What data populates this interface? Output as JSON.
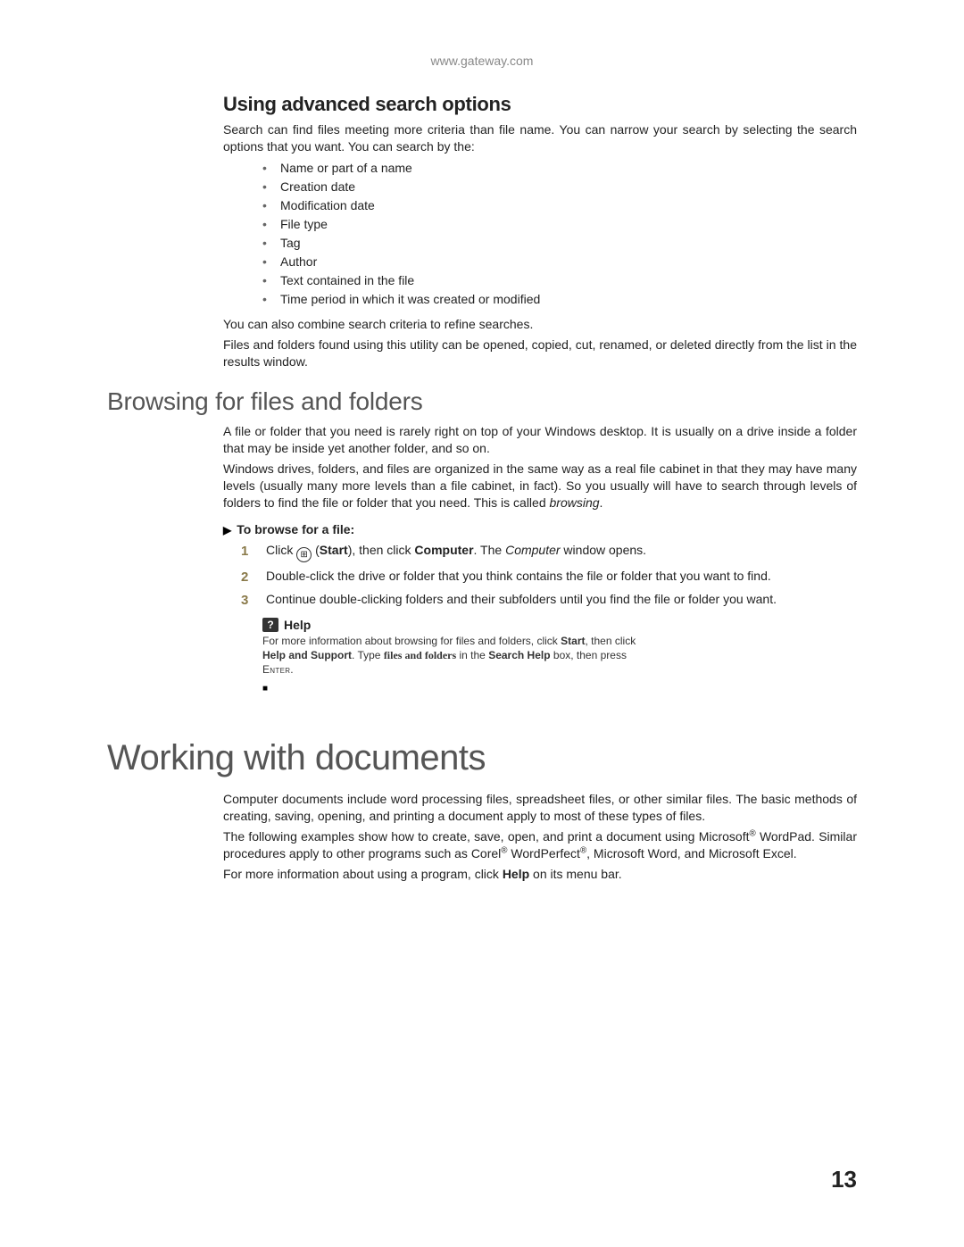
{
  "header": {
    "url": "www.gateway.com"
  },
  "sec1": {
    "heading": "Using advanced search options",
    "intro": "Search can find files meeting more criteria than file name. You can narrow your search by selecting the search options that you want. You can search by the:",
    "bullets": [
      "Name or part of a name",
      "Creation date",
      "Modification date",
      "File type",
      "Tag",
      "Author",
      "Text contained in the file",
      "Time period in which it was created or modified"
    ],
    "after1": "You can also combine search criteria to refine searches.",
    "after2": "Files and folders found using this utility can be opened, copied, cut, renamed, or deleted directly from the list in the results window."
  },
  "sec2": {
    "heading": "Browsing for files and folders",
    "p1": "A file or folder that you need is rarely right on top of your Windows desktop. It is usually on a drive inside a folder that may be inside yet another folder, and so on.",
    "p2a": "Windows drives, folders, and files are organized in the same way as a real file cabinet in that they may have many levels (usually many more levels than a file cabinet, in fact). So you usually will have to search through levels of folders to find the file or folder that you need. This is called ",
    "p2b": "browsing",
    "p2c": ".",
    "procHeading": "To browse for a file:",
    "step1": {
      "a": "Click ",
      "b": " (",
      "c": "Start",
      "d": "), then click ",
      "e": "Computer",
      "f": ". The ",
      "g": "Computer",
      "h": " window opens."
    },
    "step2": "Double-click the drive or folder that you think contains the file or folder that you want to find.",
    "step3": "Continue double-clicking folders and their subfolders until you find the file or folder you want.",
    "help": {
      "title": "Help",
      "a": "For more information about browsing for files and folders, click ",
      "b": "Start",
      "c": ", then click ",
      "d": "Help and Support",
      "e": ". Type ",
      "f": "files and folders",
      "g": " in the ",
      "h": "Search Help",
      "i": " box, then press ",
      "j": "Enter",
      "k": "."
    }
  },
  "sec3": {
    "heading": "Working with documents",
    "p1": "Computer documents include word processing files, spreadsheet files, or other similar files. The basic methods of creating, saving, opening, and printing a document apply to most of these types of files.",
    "p2a": "The following examples show how to create, save, open, and print a document using Microsoft",
    "p2b": " WordPad. Similar procedures apply to other programs such as Corel",
    "p2c": " WordPerfect",
    "p2d": ", Microsoft Word, and Microsoft Excel.",
    "p3a": "For more information about using a program, click ",
    "p3b": "Help",
    "p3c": " on its menu bar."
  },
  "pageNumber": "13"
}
